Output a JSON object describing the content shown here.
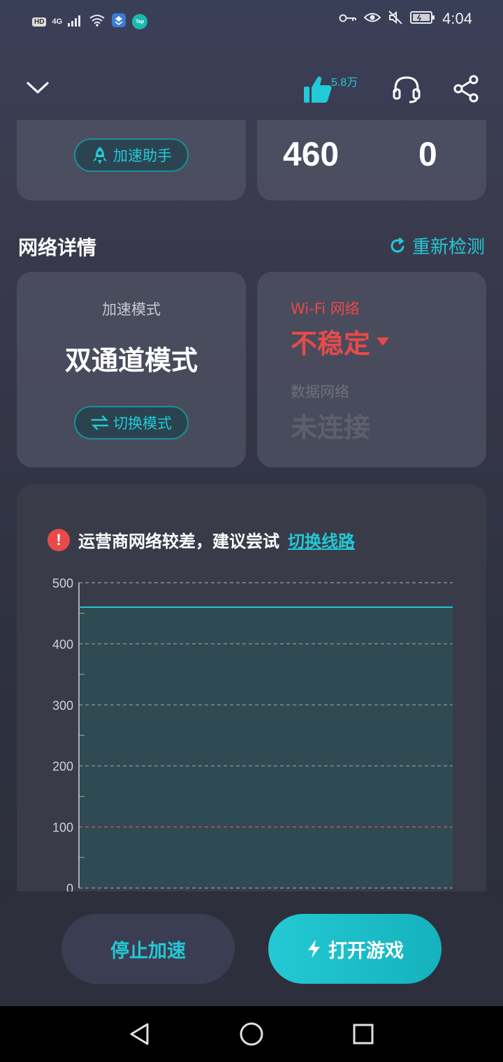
{
  "status_bar": {
    "hd": "HD",
    "net_type": "4G",
    "badge_tap": "Tap",
    "time": "4:04",
    "icons": [
      "signal-icon",
      "wifi-icon",
      "app-badge-icon",
      "tap-badge-icon",
      "key-icon",
      "eye-icon",
      "mute-icon",
      "battery-icon"
    ]
  },
  "header": {
    "like_count": "5.8万",
    "icons": [
      "chevron-down-icon",
      "thumbs-up-icon",
      "headset-icon",
      "share-icon"
    ]
  },
  "top_cards": {
    "assistant_label": "加速助手",
    "stat_1": "460",
    "stat_2": "0"
  },
  "network_section": {
    "title": "网络详情",
    "recheck_label": "重新检测"
  },
  "mode_card": {
    "label": "加速模式",
    "value": "双通道模式",
    "switch_label": "切换模式"
  },
  "network_card": {
    "wifi_label": "Wi-Fi 网络",
    "wifi_status": "不稳定",
    "data_label": "数据网络",
    "data_status": "未连接"
  },
  "chart_card": {
    "warning_text": "运营商网络较差，建议尝试",
    "warning_link": "切换线路"
  },
  "chart_data": {
    "type": "area",
    "ylim": [
      0,
      500
    ],
    "y_ticks": [
      "500",
      "400",
      "300",
      "200",
      "100",
      "0"
    ],
    "y_tick_values": [
      500,
      400,
      300,
      200,
      100,
      0
    ],
    "series": [
      {
        "values": [
          460,
          460
        ]
      }
    ],
    "threshold": 100,
    "colors": {
      "line": "#22c9d6",
      "fill": "#2f4a52",
      "threshold": "#d9534f",
      "grid": "#8a8c99"
    }
  },
  "actions": {
    "stop_label": "停止加速",
    "open_label": "打开游戏"
  },
  "nav": {
    "icons": [
      "back-icon",
      "home-icon",
      "recents-icon"
    ]
  },
  "colors": {
    "accent": "#22c9d6",
    "danger": "#e84a4a"
  }
}
